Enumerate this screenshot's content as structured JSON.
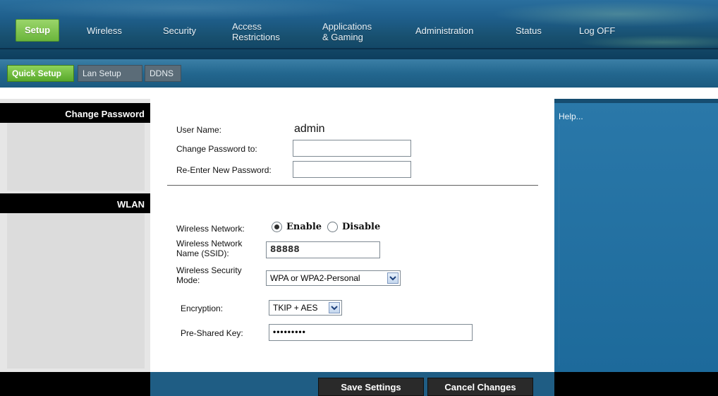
{
  "top_menu": {
    "items": [
      {
        "label": "Setup",
        "active": true
      },
      {
        "label": "Wireless"
      },
      {
        "label": "Security"
      },
      {
        "label_line1": "Access",
        "label_line2": "Restrictions"
      },
      {
        "label_line1": "Applications",
        "label_line2": "& Gaming"
      },
      {
        "label": "Administration"
      },
      {
        "label": "Status"
      },
      {
        "label": "Log OFF"
      }
    ]
  },
  "sub_tabs": [
    {
      "label": "Quick Setup",
      "active": true
    },
    {
      "label": "Lan Setup"
    },
    {
      "label": "DDNS"
    }
  ],
  "left_sections": {
    "change_password": "Change Password",
    "wlan": "WLAN"
  },
  "password_section": {
    "username_label": "User Name:",
    "username_value": "admin",
    "change_password_label": "Change Password to:",
    "reenter_label": "Re-Enter New Password:"
  },
  "wlan": {
    "wireless_network_label": "Wireless Network:",
    "enable_label": "Enable",
    "disable_label": "Disable",
    "network_state": "enable",
    "ssid_label_line1": "Wireless Network",
    "ssid_label_line2": "Name (SSID):",
    "ssid_value": "88888",
    "security_label_line1": "Wireless Security",
    "security_label_line2": "Mode:",
    "security_value": "WPA or WPA2-Personal",
    "encryption_label": "Encryption:",
    "encryption_value": "TKIP + AES",
    "psk_label": "Pre-Shared Key:",
    "psk_value": "•••••••••"
  },
  "help": {
    "text": "Help..."
  },
  "actions": {
    "save": "Save Settings",
    "cancel": "Cancel Changes"
  },
  "colors": {
    "active_green": "#6ab53c",
    "nav_blue": "#1f5f8c",
    "help_blue": "#2a78a9",
    "black": "#000000"
  }
}
